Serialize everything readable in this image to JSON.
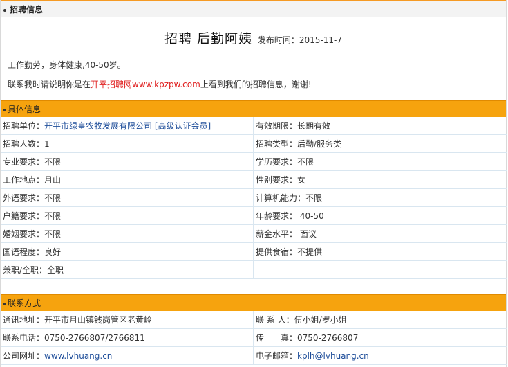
{
  "header": {
    "title": "招聘信息"
  },
  "job": {
    "title": "招聘 后勤阿姨",
    "publish_label": "发布时间：",
    "publish_date": "2015-11-7",
    "description": "工作勤劳，身体健康,40-50岁。",
    "contact_prefix": "联系我时请说明你是在",
    "contact_site": "开平招聘网www.kpzpw.com",
    "contact_suffix": "上看到我们的招聘信息，谢谢!"
  },
  "details": {
    "section_title": "具体信息",
    "rows": [
      {
        "left_label": "招聘单位：",
        "left_value": "开平市绿皇农牧发展有限公司 [高级认证会员]",
        "right_label": "有效期限：",
        "right_value": "长期有效"
      },
      {
        "left_label": "招聘人数：",
        "left_value": "1",
        "right_label": "招聘类型：",
        "right_value": "后勤/服务类"
      },
      {
        "left_label": "专业要求：",
        "left_value": "不限",
        "right_label": "学历要求：",
        "right_value": "不限"
      },
      {
        "left_label": "工作地点：",
        "left_value": "月山",
        "right_label": "性别要求：",
        "right_value": "女"
      },
      {
        "left_label": "外语要求：",
        "left_value": "不限",
        "right_label": "计算机能力：",
        "right_value": "不限"
      },
      {
        "left_label": "户籍要求：",
        "left_value": "不限",
        "right_label": "年龄要求：",
        "right_value": " 40-50"
      },
      {
        "left_label": "婚姻要求：",
        "left_value": "不限",
        "right_label": "薪金水平：",
        "right_value": " 面议"
      },
      {
        "left_label": "国语程度：",
        "left_value": "良好",
        "right_label": "提供食宿：",
        "right_value": "不提供"
      },
      {
        "left_label": "兼职/全职：",
        "left_value": "全职",
        "right_label": "",
        "right_value": ""
      }
    ]
  },
  "contact": {
    "section_title": "联系方式",
    "address_label": "通讯地址：",
    "address": "开平市月山镇钱岗管区老黄岭",
    "person_label": "联 系 人：",
    "person": "伍小姐/罗小姐",
    "phone_label": "联系电话：",
    "phone": "0750-2766807/2766811",
    "fax_label": "传　　真：",
    "fax": "0750-2766807",
    "website_label": "公司网址：",
    "website": "www.lvhuang.cn",
    "email_label": "电子邮箱：",
    "email": "kplh@lvhuang.cn"
  },
  "colors": {
    "accent": "#f6a30e",
    "link": "#1f4e9a",
    "highlight": "#e02020"
  }
}
